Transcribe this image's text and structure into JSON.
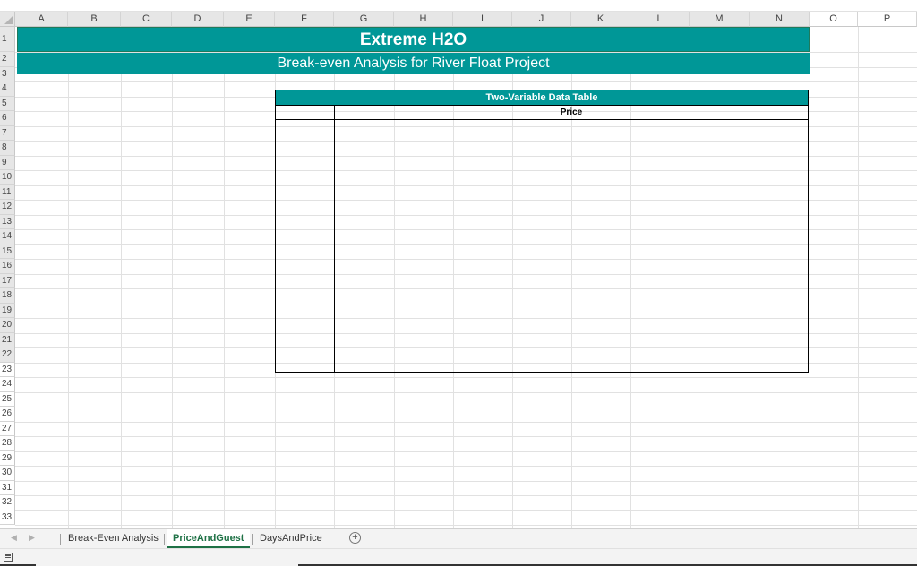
{
  "columns": [
    "A",
    "B",
    "C",
    "D",
    "E",
    "F",
    "G",
    "H",
    "I",
    "J",
    "K",
    "L",
    "M",
    "N",
    "O",
    "P"
  ],
  "rows": [
    "1",
    "2",
    "3",
    "4",
    "5",
    "6",
    "7",
    "8",
    "9",
    "10",
    "11",
    "12",
    "13",
    "14",
    "15",
    "16",
    "17",
    "18",
    "19",
    "20",
    "21",
    "22",
    "23",
    "24",
    "25",
    "26",
    "27",
    "28",
    "29",
    "30",
    "31",
    "32",
    "33"
  ],
  "banner": {
    "title": "Extreme H2O",
    "subtitle": "Break-even Analysis for River Float Project"
  },
  "data_table": {
    "header": "Two-Variable Data Table",
    "column_label": "Price"
  },
  "sheet_tabs": [
    {
      "label": "Break-Even Analysis",
      "active": false
    },
    {
      "label": "PriceAndGuest",
      "active": true
    },
    {
      "label": "DaysAndPrice",
      "active": false
    }
  ],
  "add_sheet_symbol": "+",
  "colors": {
    "banner_fill": "#009797",
    "active_tab_text": "#1e7145",
    "header_fill": "#e6e6e6"
  }
}
